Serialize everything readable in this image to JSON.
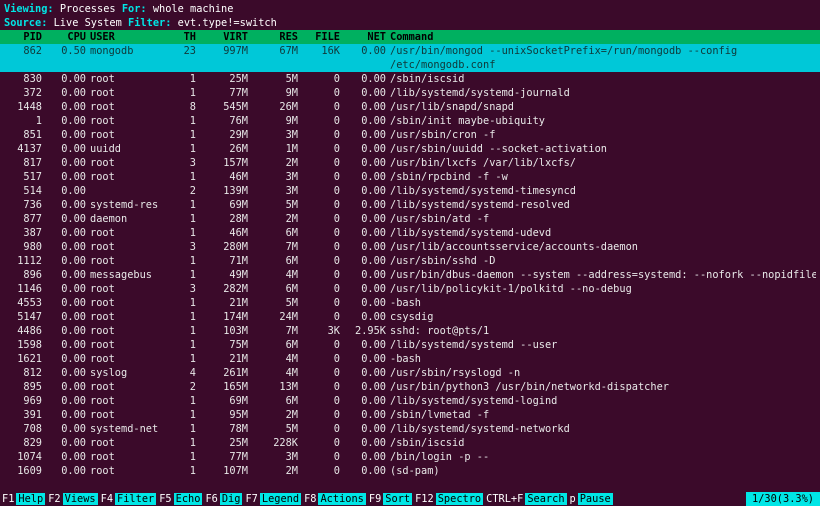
{
  "top": {
    "viewing_label": "Viewing:",
    "viewing_value": "Processes",
    "for_label": "For:",
    "for_value": "whole machine",
    "source_label": "Source:",
    "source_value": "Live System",
    "filter_label": "Filter:",
    "filter_value": "evt.type!=switch"
  },
  "columns": {
    "pid": "PID",
    "cpu": "CPU",
    "user": "USER",
    "th": "TH",
    "virt": "VIRT",
    "res": "RES",
    "file": "FILE",
    "net": "NET",
    "cmd": "Command"
  },
  "selected": {
    "pid": "862",
    "cpu": "0.50",
    "user": "mongodb",
    "th": "23",
    "virt": "997M",
    "res": "67M",
    "file": "16K",
    "net": "0.00",
    "cmd": "/usr/bin/mongod --unixSocketPrefix=/run/mongodb --config /etc/mongodb.conf"
  },
  "rows": [
    {
      "pid": "830",
      "cpu": "0.00",
      "user": "root",
      "th": "1",
      "virt": "25M",
      "res": "5M",
      "file": "0",
      "net": "0.00",
      "cmd": "/sbin/iscsid"
    },
    {
      "pid": "372",
      "cpu": "0.00",
      "user": "root",
      "th": "1",
      "virt": "77M",
      "res": "9M",
      "file": "0",
      "net": "0.00",
      "cmd": "/lib/systemd/systemd-journald"
    },
    {
      "pid": "1448",
      "cpu": "0.00",
      "user": "root",
      "th": "8",
      "virt": "545M",
      "res": "26M",
      "file": "0",
      "net": "0.00",
      "cmd": "/usr/lib/snapd/snapd"
    },
    {
      "pid": "1",
      "cpu": "0.00",
      "user": "root",
      "th": "1",
      "virt": "76M",
      "res": "9M",
      "file": "0",
      "net": "0.00",
      "cmd": "/sbin/init maybe-ubiquity"
    },
    {
      "pid": "851",
      "cpu": "0.00",
      "user": "root",
      "th": "1",
      "virt": "29M",
      "res": "3M",
      "file": "0",
      "net": "0.00",
      "cmd": "/usr/sbin/cron -f"
    },
    {
      "pid": "4137",
      "cpu": "0.00",
      "user": "uuidd",
      "th": "1",
      "virt": "26M",
      "res": "1M",
      "file": "0",
      "net": "0.00",
      "cmd": "/usr/sbin/uuidd --socket-activation"
    },
    {
      "pid": "817",
      "cpu": "0.00",
      "user": "root",
      "th": "3",
      "virt": "157M",
      "res": "2M",
      "file": "0",
      "net": "0.00",
      "cmd": "/usr/bin/lxcfs /var/lib/lxcfs/"
    },
    {
      "pid": "517",
      "cpu": "0.00",
      "user": "root",
      "th": "1",
      "virt": "46M",
      "res": "3M",
      "file": "0",
      "net": "0.00",
      "cmd": "/sbin/rpcbind -f -w"
    },
    {
      "pid": "514",
      "cpu": "0.00",
      "user": "",
      "th": "2",
      "virt": "139M",
      "res": "3M",
      "file": "0",
      "net": "0.00",
      "cmd": "/lib/systemd/systemd-timesyncd"
    },
    {
      "pid": "736",
      "cpu": "0.00",
      "user": "systemd-res",
      "th": "1",
      "virt": "69M",
      "res": "5M",
      "file": "0",
      "net": "0.00",
      "cmd": "/lib/systemd/systemd-resolved"
    },
    {
      "pid": "877",
      "cpu": "0.00",
      "user": "daemon",
      "th": "1",
      "virt": "28M",
      "res": "2M",
      "file": "0",
      "net": "0.00",
      "cmd": "/usr/sbin/atd -f"
    },
    {
      "pid": "387",
      "cpu": "0.00",
      "user": "root",
      "th": "1",
      "virt": "46M",
      "res": "6M",
      "file": "0",
      "net": "0.00",
      "cmd": "/lib/systemd/systemd-udevd"
    },
    {
      "pid": "980",
      "cpu": "0.00",
      "user": "root",
      "th": "3",
      "virt": "280M",
      "res": "7M",
      "file": "0",
      "net": "0.00",
      "cmd": "/usr/lib/accountsservice/accounts-daemon"
    },
    {
      "pid": "1112",
      "cpu": "0.00",
      "user": "root",
      "th": "1",
      "virt": "71M",
      "res": "6M",
      "file": "0",
      "net": "0.00",
      "cmd": "/usr/sbin/sshd -D"
    },
    {
      "pid": "896",
      "cpu": "0.00",
      "user": "messagebus",
      "th": "1",
      "virt": "49M",
      "res": "4M",
      "file": "0",
      "net": "0.00",
      "cmd": "/usr/bin/dbus-daemon --system --address=systemd: --nofork --nopidfile --systemd-activ"
    },
    {
      "pid": "1146",
      "cpu": "0.00",
      "user": "root",
      "th": "3",
      "virt": "282M",
      "res": "6M",
      "file": "0",
      "net": "0.00",
      "cmd": "/usr/lib/policykit-1/polkitd --no-debug"
    },
    {
      "pid": "4553",
      "cpu": "0.00",
      "user": "root",
      "th": "1",
      "virt": "21M",
      "res": "5M",
      "file": "0",
      "net": "0.00",
      "cmd": "-bash"
    },
    {
      "pid": "5147",
      "cpu": "0.00",
      "user": "root",
      "th": "1",
      "virt": "174M",
      "res": "24M",
      "file": "0",
      "net": "0.00",
      "cmd": "csysdig"
    },
    {
      "pid": "4486",
      "cpu": "0.00",
      "user": "root",
      "th": "1",
      "virt": "103M",
      "res": "7M",
      "file": "3K",
      "net": "2.95K",
      "cmd": "sshd: root@pts/1"
    },
    {
      "pid": "1598",
      "cpu": "0.00",
      "user": "root",
      "th": "1",
      "virt": "75M",
      "res": "6M",
      "file": "0",
      "net": "0.00",
      "cmd": "/lib/systemd/systemd --user"
    },
    {
      "pid": "1621",
      "cpu": "0.00",
      "user": "root",
      "th": "1",
      "virt": "21M",
      "res": "4M",
      "file": "0",
      "net": "0.00",
      "cmd": "-bash"
    },
    {
      "pid": "812",
      "cpu": "0.00",
      "user": "syslog",
      "th": "4",
      "virt": "261M",
      "res": "4M",
      "file": "0",
      "net": "0.00",
      "cmd": "/usr/sbin/rsyslogd -n"
    },
    {
      "pid": "895",
      "cpu": "0.00",
      "user": "root",
      "th": "2",
      "virt": "165M",
      "res": "13M",
      "file": "0",
      "net": "0.00",
      "cmd": "/usr/bin/python3 /usr/bin/networkd-dispatcher"
    },
    {
      "pid": "969",
      "cpu": "0.00",
      "user": "root",
      "th": "1",
      "virt": "69M",
      "res": "6M",
      "file": "0",
      "net": "0.00",
      "cmd": "/lib/systemd/systemd-logind"
    },
    {
      "pid": "391",
      "cpu": "0.00",
      "user": "root",
      "th": "1",
      "virt": "95M",
      "res": "2M",
      "file": "0",
      "net": "0.00",
      "cmd": "/sbin/lvmetad -f"
    },
    {
      "pid": "708",
      "cpu": "0.00",
      "user": "systemd-net",
      "th": "1",
      "virt": "78M",
      "res": "5M",
      "file": "0",
      "net": "0.00",
      "cmd": "/lib/systemd/systemd-networkd"
    },
    {
      "pid": "829",
      "cpu": "0.00",
      "user": "root",
      "th": "1",
      "virt": "25M",
      "res": "228K",
      "file": "0",
      "net": "0.00",
      "cmd": "/sbin/iscsid"
    },
    {
      "pid": "1074",
      "cpu": "0.00",
      "user": "root",
      "th": "1",
      "virt": "77M",
      "res": "3M",
      "file": "0",
      "net": "0.00",
      "cmd": "/bin/login -p --"
    },
    {
      "pid": "1609",
      "cpu": "0.00",
      "user": "root",
      "th": "1",
      "virt": "107M",
      "res": "2M",
      "file": "0",
      "net": "0.00",
      "cmd": "(sd-pam)"
    }
  ],
  "footer": {
    "keys": [
      {
        "k": "F1",
        "a": "Help"
      },
      {
        "k": "F2",
        "a": "Views"
      },
      {
        "k": "F4",
        "a": "Filter"
      },
      {
        "k": "F5",
        "a": "Echo"
      },
      {
        "k": "F6",
        "a": "Dig"
      },
      {
        "k": "F7",
        "a": "Legend"
      },
      {
        "k": "F8",
        "a": "Actions"
      },
      {
        "k": "F9",
        "a": "Sort"
      },
      {
        "k": "F12",
        "a": "Spectro"
      },
      {
        "k": "CTRL+F",
        "a": "Search"
      },
      {
        "k": "p",
        "a": "Pause"
      }
    ],
    "status": "1/30(3.3%)"
  }
}
